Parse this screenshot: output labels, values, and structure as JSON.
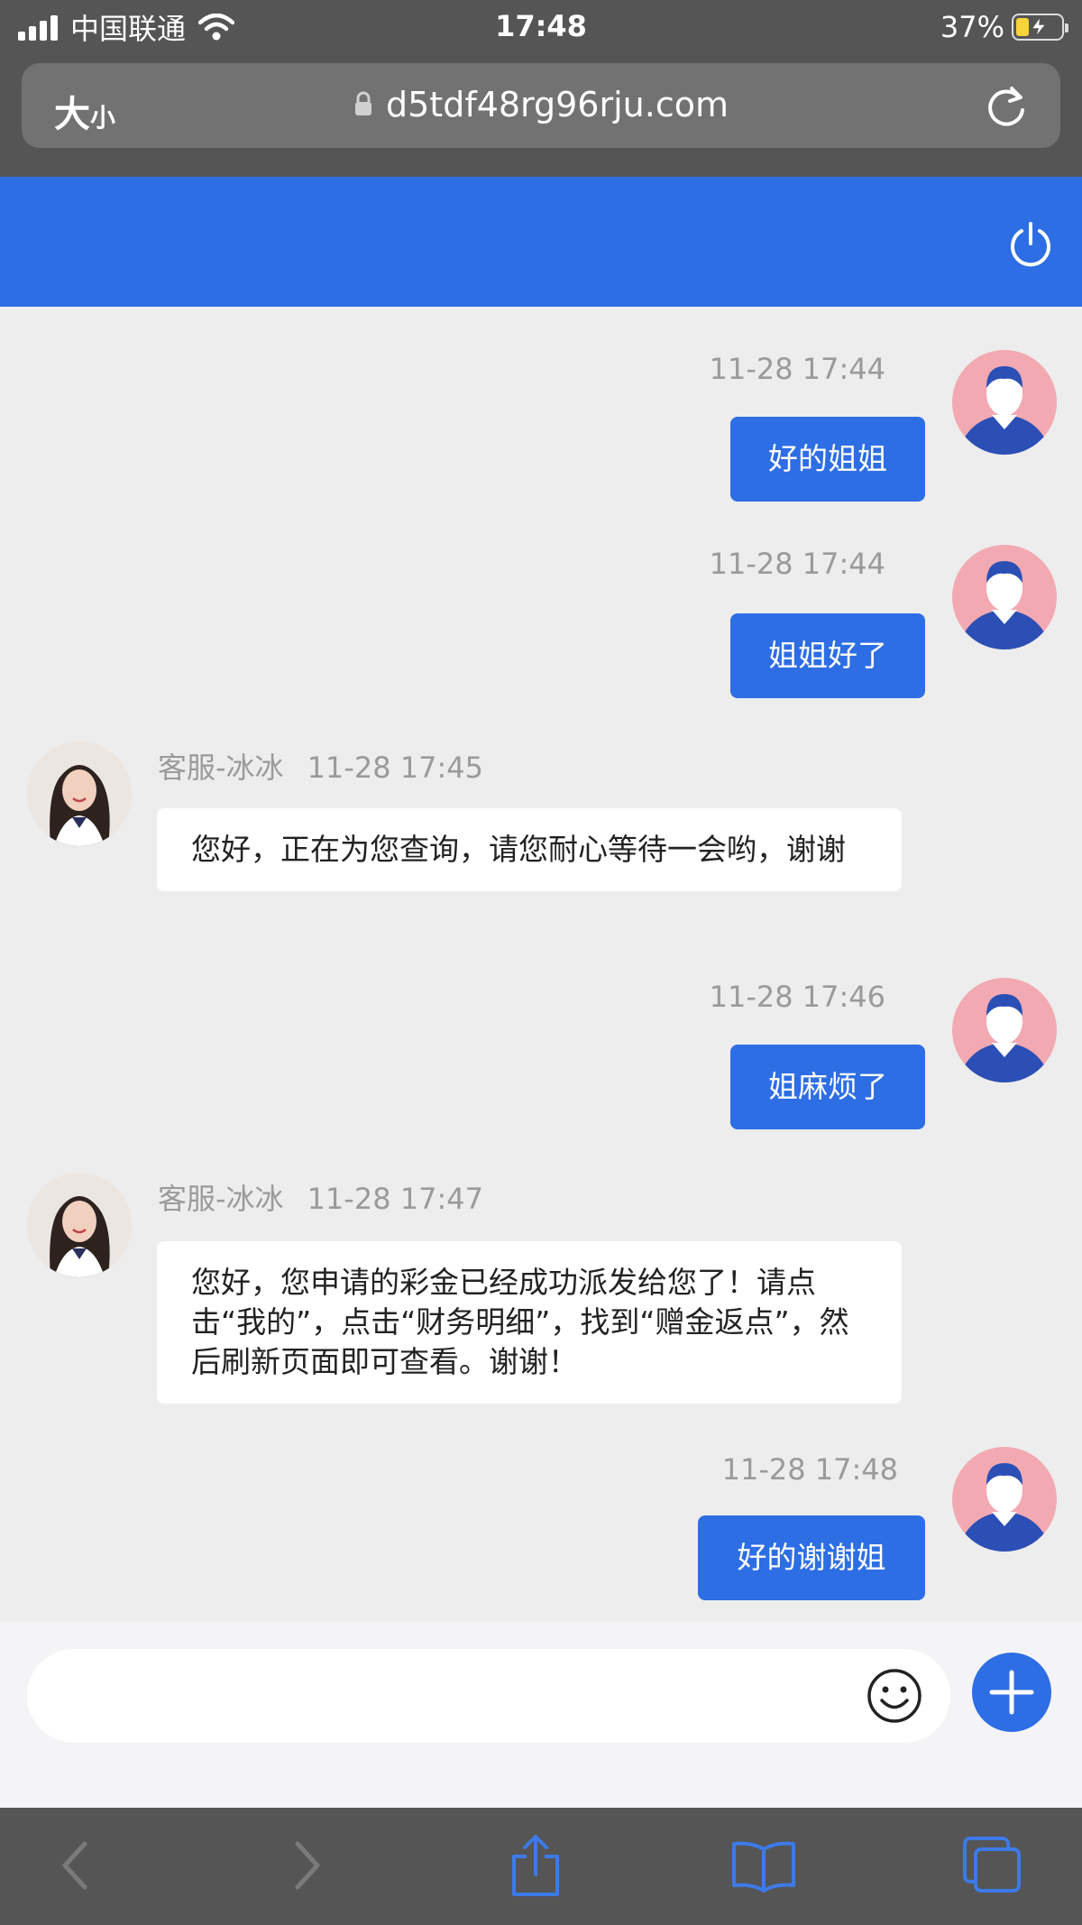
{
  "status_bar": {
    "carrier": "中国联通",
    "time": "17:48",
    "battery": "37%"
  },
  "browser": {
    "text_size_label_big": "大",
    "text_size_label_small": "小",
    "url": "d5tdf48rg96rju.com"
  },
  "messages": [
    {
      "sender": "me",
      "time": "11-28 17:44",
      "text": "好的姐姐"
    },
    {
      "sender": "me",
      "time": "11-28 17:44",
      "text": "姐姐好了"
    },
    {
      "sender": "agent",
      "name": "客服-冰冰",
      "time": "11-28 17:45",
      "text": "您好，正在为您查询，请您耐心等待一会哟，谢谢"
    },
    {
      "sender": "me",
      "time": "11-28 17:46",
      "text": "姐麻烦了"
    },
    {
      "sender": "agent",
      "name": "客服-冰冰",
      "time": "11-28 17:47",
      "text": "您好，您申请的彩金已经成功派发给您了！请点击“我的”，点击“财务明细”，找到“赠金返点”，然后刷新页面即可查看。谢谢！"
    },
    {
      "sender": "me",
      "time": "11-28 17:48",
      "text": "好的谢谢姐"
    }
  ],
  "composer": {
    "placeholder": ""
  },
  "icons": {
    "header_right": "power-icon",
    "composer_emoji": "emoji-icon",
    "composer_add": "plus-icon",
    "toolbar": [
      "back-icon",
      "forward-icon",
      "share-icon",
      "bookmarks-icon",
      "tabs-icon"
    ]
  },
  "colors": {
    "accent": "#2d6ee4",
    "chat_bg": "#ededed",
    "browser_chrome": "#555555",
    "user_avatar_bg": "#f3a9b1"
  }
}
